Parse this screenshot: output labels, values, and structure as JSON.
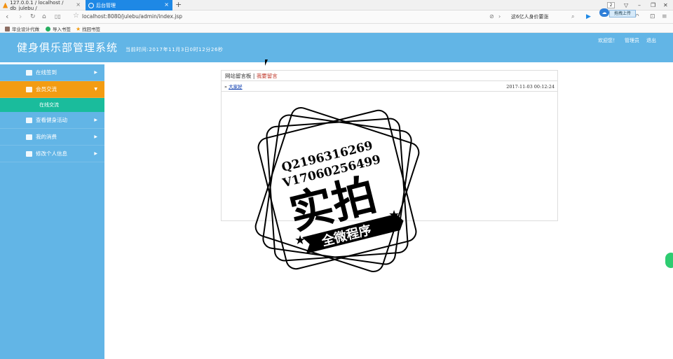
{
  "browser": {
    "tabs": [
      {
        "title": "127.0.0.1 / localhost / db_julebu /",
        "active": false
      },
      {
        "title": "后台管理",
        "active": true
      }
    ],
    "url": "localhost:8080/julebu/admin/index.jsp",
    "search_text": "这6亿人身价要涨",
    "download_badge": "2",
    "upload_tip": "拖拽上传",
    "bookmarks": [
      "毕业设计代做",
      "导入书签",
      "找回书签"
    ]
  },
  "header": {
    "title": "健身俱乐部管理系统",
    "time_label": "当前时间:2017年11月3日0时12分26秒",
    "welcome": "欢迎您！",
    "user": "管理员",
    "logout": "退出"
  },
  "sidebar": {
    "items": [
      {
        "label": "在线签到",
        "arrow": "▶"
      },
      {
        "label": "会员交流",
        "arrow": "▼",
        "active": true
      },
      {
        "label": "查看健身活动",
        "arrow": "▶"
      },
      {
        "label": "我的消费",
        "arrow": "▶"
      },
      {
        "label": "修改个人信息",
        "arrow": "▶"
      }
    ],
    "subitem": "在线交流"
  },
  "board": {
    "title": "网站留言板",
    "separator": "|",
    "write_link": "我要留言",
    "message": {
      "prefix": "»",
      "author": "大家好",
      "time": "2017-11-03 00:12:24"
    }
  },
  "watermark": {
    "line1": "Q2196316269",
    "line2": "V17060256499",
    "big": "实拍",
    "banner": "全微程序"
  },
  "colors": {
    "header_bg": "#62b5e6",
    "active_menu": "#f39c12",
    "submenu": "#1abc9c",
    "tab_active": "#1e88e5"
  }
}
